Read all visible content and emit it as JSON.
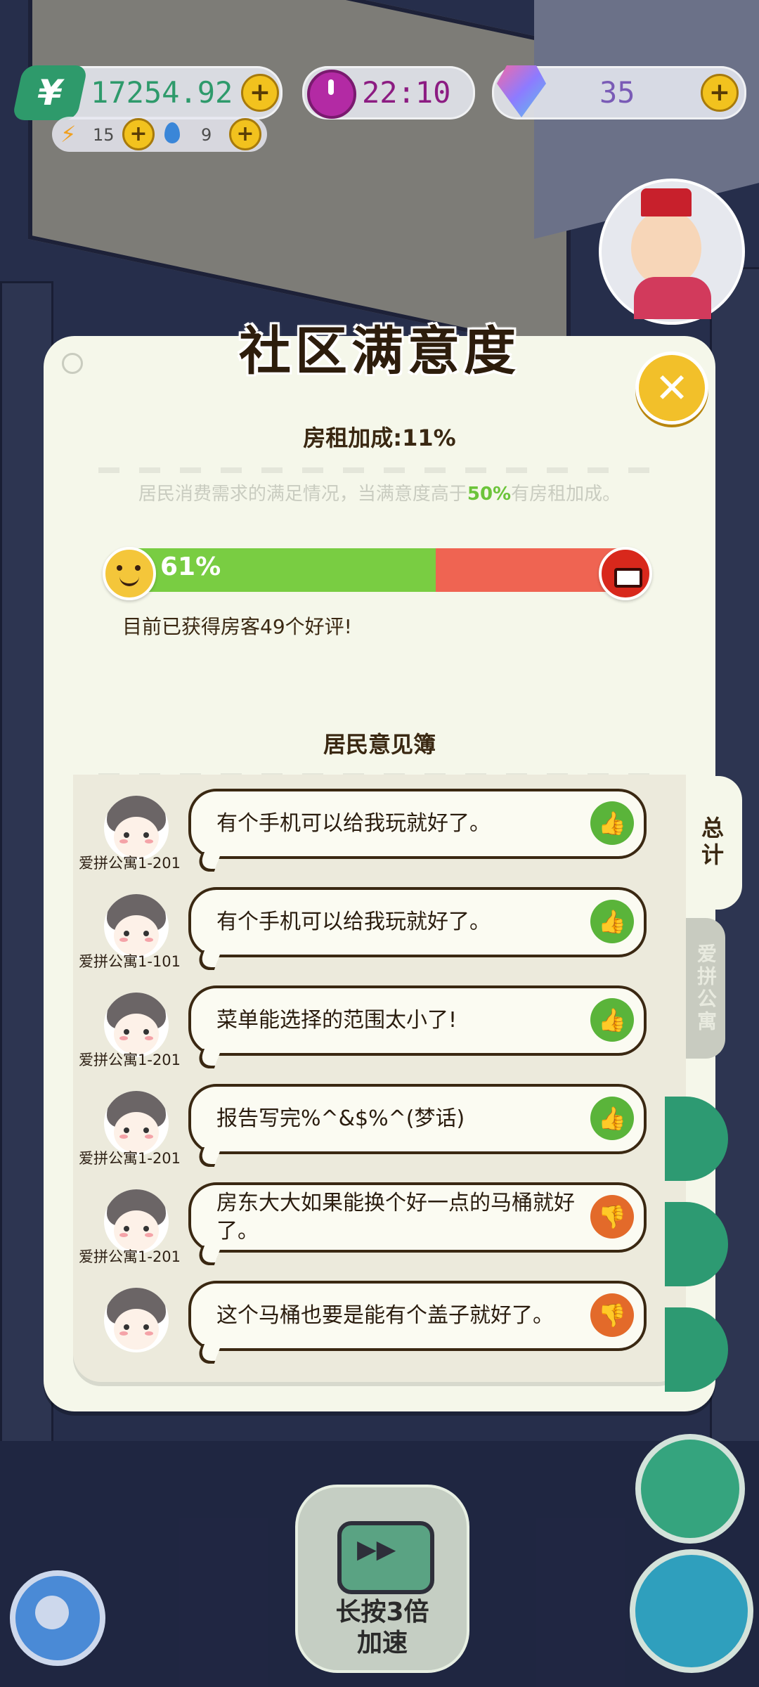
{
  "hud": {
    "money": "17254.92",
    "money_icon": "¥",
    "time": "22:10",
    "gems": "35",
    "energy": "15",
    "water": "9",
    "plus": "+"
  },
  "room_sign": "1-201",
  "modal": {
    "title": "社区满意度",
    "close": "✕",
    "rent_bonus": "房租加成:11%",
    "desc_before": "居民消费需求的满足情况，当满意度高于",
    "desc_highlight": "50%",
    "desc_after": "有房租加成。",
    "satisfaction_label": "61%",
    "satisfaction_value": 0.61,
    "good_reviews": "目前已获得房客49个好评!",
    "book_title": "居民意见簿",
    "tab_total": "总计",
    "tab_apartment": "爱拼公寓"
  },
  "reviews": [
    {
      "who": "爱拼公寓1-201",
      "msg": "有个手机可以给我玩就好了。",
      "type": "up"
    },
    {
      "who": "爱拼公寓1-101",
      "msg": "有个手机可以给我玩就好了。",
      "type": "up"
    },
    {
      "who": "爱拼公寓1-201",
      "msg": "菜单能选择的范围太小了!",
      "type": "up"
    },
    {
      "who": "爱拼公寓1-201",
      "msg": "报告写完%^&$%^(梦话)",
      "type": "up"
    },
    {
      "who": "爱拼公寓1-201",
      "msg": "房东大大如果能换个好一点的马桶就好了。",
      "type": "down"
    },
    {
      "who": "",
      "msg": "这个马桶也要是能有个盖子就好了。",
      "type": "down"
    }
  ],
  "speed_button": {
    "line1": "长按3倍",
    "line2": "加速"
  },
  "colors": {
    "good": "#79cd42",
    "bad": "#ef6452",
    "accent": "#f2c02a"
  }
}
